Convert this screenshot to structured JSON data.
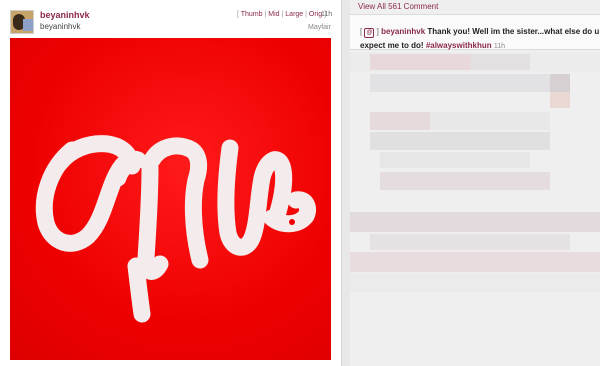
{
  "post": {
    "username": "beyaninhvk",
    "display_name": "beyaninhvk",
    "sizes": [
      "Thumb",
      "Mid",
      "Large",
      "Orig"
    ],
    "time": "11h",
    "location": "Mayfair"
  },
  "comments_link": "View All 561 Comment",
  "comment": {
    "username": "beyaninhvk",
    "message": "Thank you! Well im the sister...what else do u expect me to do!",
    "hashtag": "#alwayswithkhun",
    "time": "11h"
  },
  "colors": {
    "accent": "#8b2a4a",
    "photo_red": "#ee0000"
  }
}
